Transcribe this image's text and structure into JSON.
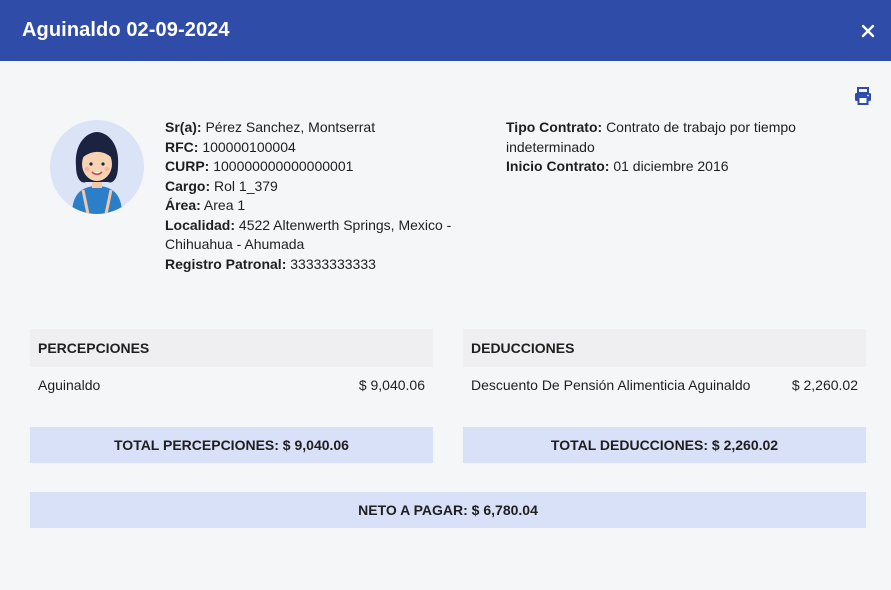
{
  "header": {
    "title": "Aguinaldo 02-09-2024"
  },
  "employee": {
    "name_label": "Sr(a):",
    "name": "Pérez Sanchez, Montserrat",
    "rfc_label": "RFC:",
    "rfc": "100000100004",
    "curp_label": "CURP:",
    "curp": "100000000000000001",
    "cargo_label": "Cargo:",
    "cargo": "Rol 1_379",
    "area_label": "Área:",
    "area": "Area 1",
    "localidad_label": "Localidad:",
    "localidad": "4522 Altenwerth Springs, Mexico - Chihuahua - Ahumada",
    "registro_label": "Registro Patronal:",
    "registro": "33333333333",
    "tipo_contrato_label": "Tipo Contrato:",
    "tipo_contrato": "Contrato de trabajo por tiempo indeterminado",
    "inicio_contrato_label": "Inicio Contrato:",
    "inicio_contrato": "01 diciembre 2016"
  },
  "percepciones": {
    "title": "PERCEPCIONES",
    "items": [
      {
        "label": "Aguinaldo",
        "amount": "$ 9,040.06"
      }
    ],
    "total": "TOTAL PERCEPCIONES: $ 9,040.06"
  },
  "deducciones": {
    "title": "DEDUCCIONES",
    "items": [
      {
        "label": "Descuento De Pensión Alimenticia Aguinaldo",
        "amount": "$ 2,260.02"
      }
    ],
    "total": "TOTAL DEDUCCIONES: $ 2,260.02"
  },
  "neto": "NETO A PAGAR: $ 6,780.04",
  "colors": {
    "header": "#2e4ca8",
    "total_bg": "#d9e1f8",
    "section_bg": "#efeff1",
    "icon": "#2e4ca8"
  },
  "icons": {
    "close": "close-icon",
    "print": "printer-icon",
    "avatar": "avatar-woman"
  }
}
